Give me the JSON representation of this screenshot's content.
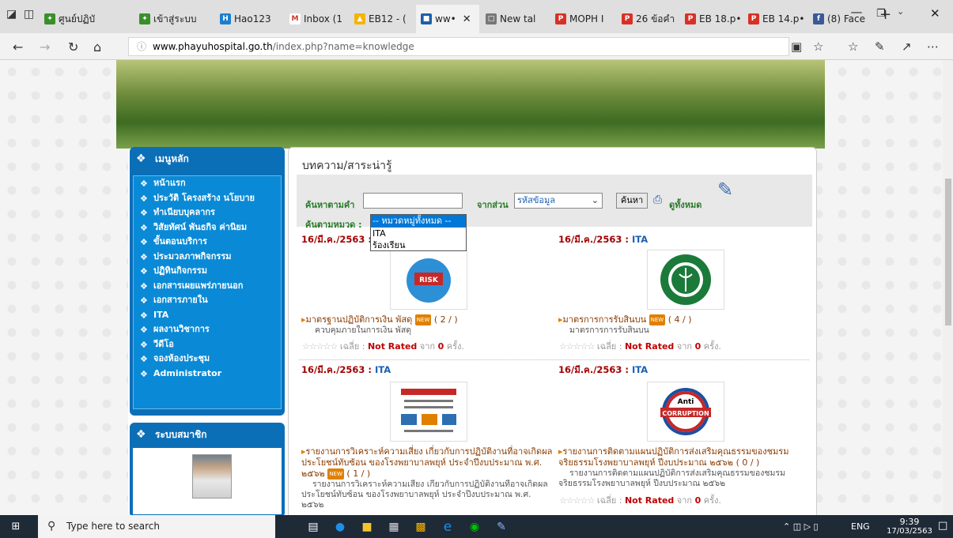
{
  "browser": {
    "tabs": [
      {
        "label": "ศูนย์ปฏิบั",
        "color": "#3a8f2a"
      },
      {
        "label": "เข้าสู่ระบบ",
        "color": "#3a8f2a"
      },
      {
        "label": "Hao123",
        "color": "#1a7fd0"
      },
      {
        "label": "Inbox (1",
        "color": "#c53929"
      },
      {
        "label": "EB12 - (",
        "color": "#f4b400"
      },
      {
        "label": "ww•",
        "color": "#1d5fa8"
      },
      {
        "label": "New tal",
        "color": "#777777"
      },
      {
        "label": "MOPH I",
        "color": "#d93025"
      },
      {
        "label": "26 ข้อคำ",
        "color": "#d93025"
      },
      {
        "label": "EB 18.p•",
        "color": "#d93025"
      },
      {
        "label": "EB 14.p•",
        "color": "#d93025"
      },
      {
        "label": "(8) Face",
        "color": "#3b5998"
      }
    ],
    "url_host": "www.phayuhospital.go.th",
    "url_path": "/index.php?name=knowledge"
  },
  "sidebar": {
    "menu_title": "เมนูหลัก",
    "items": [
      "หน้าแรก",
      "ประวัติ โครงสร้าง นโยบาย",
      "ทำเนียบบุคลากร",
      "วิสัยทัศน์ พันธกิจ ค่านิยม",
      "ขั้นตอนบริการ",
      "ประมวลภาพกิจกรรม",
      "ปฏิทินกิจกรรม",
      "เอกสารเผยแพร่ภายนอก",
      "เอกสารภายใน",
      "ITA",
      "ผลงานวิชาการ",
      "วีดีโอ",
      "จองห้องประชุม",
      "Administrator"
    ],
    "member_title": "ระบบสมาชิก"
  },
  "main": {
    "title": "บทความ/สาระน่ารู้",
    "search_label": "ค้นหาตามคำ",
    "search_value": "",
    "from_label": "จากส่วน",
    "from_select": "รหัสข้อมูล",
    "search_button": "ค้นหา",
    "view_all": "ดูทั้งหมด",
    "category_label": "ค้นตามหมวด :",
    "category_options": [
      "-- หมวดหมู่ทั้งหมด --",
      "ITA",
      "ร้องเรียน"
    ],
    "articles": [
      {
        "date": "16/มี.ค./2563 : ",
        "category": "ITA",
        "title": "มาตรฐานปฏิบัติการเงิน พัสดุ",
        "new": "NEW",
        "count": "( 2 / )",
        "desc": "ควบคุมภายในการเงิน พัสดุ",
        "avg_label": "เฉลี่ย : ",
        "rating": "Not Rated",
        "from": "จาก",
        "votes": "0",
        "times": "ครั้ง."
      },
      {
        "date": "16/มี.ค./2563 : ",
        "category": "ITA",
        "title": "มาตรการการรับสินบน",
        "new": "NEW",
        "count": "( 4 / )",
        "desc": "มาตรการการรับสินบน",
        "avg_label": "เฉลี่ย : ",
        "rating": "Not Rated",
        "from": "จาก",
        "votes": "0",
        "times": "ครั้ง."
      },
      {
        "date": "16/มี.ค./2563 : ",
        "category": "ITA",
        "title": "รายงานการวิเคราะห์ความเสี่ยง เกี่ยวกับการปฏิบัติงานที่อาจเกิดผลประโยชน์ทับซ้อน ของโรงพยาบาลพยุห์ ประจำปีงบประมาณ พ.ศ. ๒๕๖๒",
        "new": "NEW",
        "count": "( 1 / )",
        "desc": "รายงานการวิเคราะห์ความเสี่ยง เกี่ยวกับการปฏิบัติงานที่อาจเกิดผลประโยชน์ทับซ้อน ของโรงพยาบาลพยุห์ ประจำปีงบประมาณ พ.ศ. ๒๕๖๒"
      },
      {
        "date": "16/มี.ค./2563 : ",
        "category": "ITA",
        "title": "รายงานการติดตามแผนปฏิบัติการส่งเสริมคุณธรรมของชมรมจริยธรรมโรงพยาบาลพยุห์ ปีงบประมาณ ๒๕๖๒",
        "count": "( 0 / )",
        "desc": "รายงานการติดตามแผนปฏิบัติการส่งเสริมคุณธรรมของชมรมจริยธรรมโรงพยาบาลพยุห์ ปีงบประมาณ ๒๕๖๒",
        "avg_label": "เฉลี่ย : ",
        "rating": "Not Rated",
        "from": "จาก",
        "votes": "0",
        "times": "ครั้ง."
      }
    ]
  },
  "taskbar": {
    "search_placeholder": "Type here to search",
    "lang": "ENG",
    "time": "9:39",
    "date": "17/03/2563"
  }
}
